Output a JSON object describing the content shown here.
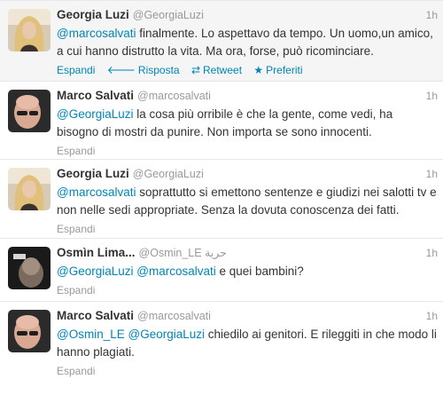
{
  "tweets": [
    {
      "fullname": "Georgia Luzi",
      "username": "@GeorgiaLuzi",
      "time": "1h",
      "mention": "@marcosalvati",
      "text": " finalmente. Lo aspettavo da tempo. Un uomo,un amico, a cui hanno distrutto la vita. Ma ora, forse, può ricominciare.",
      "expand": "Espandi",
      "actions": {
        "reply": "Risposta",
        "retweet": "Retweet",
        "favorite": "Preferiti"
      }
    },
    {
      "fullname": "Marco Salvati",
      "username": "@marcosalvati",
      "time": "1h",
      "mention": "@GeorgiaLuzi",
      "text": " la cosa più orribile è che la gente, come vedi, ha bisogno di mostri da punire. Non importa se sono innocenti.",
      "expand": "Espandi"
    },
    {
      "fullname": "Georgia Luzi",
      "username": "@GeorgiaLuzi",
      "time": "1h",
      "mention": "@marcosalvati",
      "text": " soprattutto si emettono sentenze e giudizi nei salotti tv e non nelle sedi appropriate. Senza la dovuta conoscenza dei fatti.",
      "expand": "Espandi"
    },
    {
      "fullname": "Osmìn Lima...",
      "username": "@Osmin_LE حرية",
      "time": "1h",
      "mention1": "@GeorgiaLuzi",
      "mention2": "@marcosalvati",
      "text": " e quei bambini?",
      "expand": "Espandi"
    },
    {
      "fullname": "Marco Salvati",
      "username": "@marcosalvati",
      "time": "1h",
      "mention1": "@Osmin_LE",
      "mention2": "@GeorgiaLuzi",
      "text": " chiedilo ai genitori. E rileggiti in che modo li hanno plagiati.",
      "expand": "Espandi"
    }
  ],
  "icons": {
    "reply": "reply-arrow-icon",
    "retweet": "retweet-icon",
    "favorite": "star-icon"
  },
  "colors": {
    "link": "#0084b4",
    "muted": "#999999",
    "text": "#333333",
    "hover_bg": "#f5f5f5"
  }
}
